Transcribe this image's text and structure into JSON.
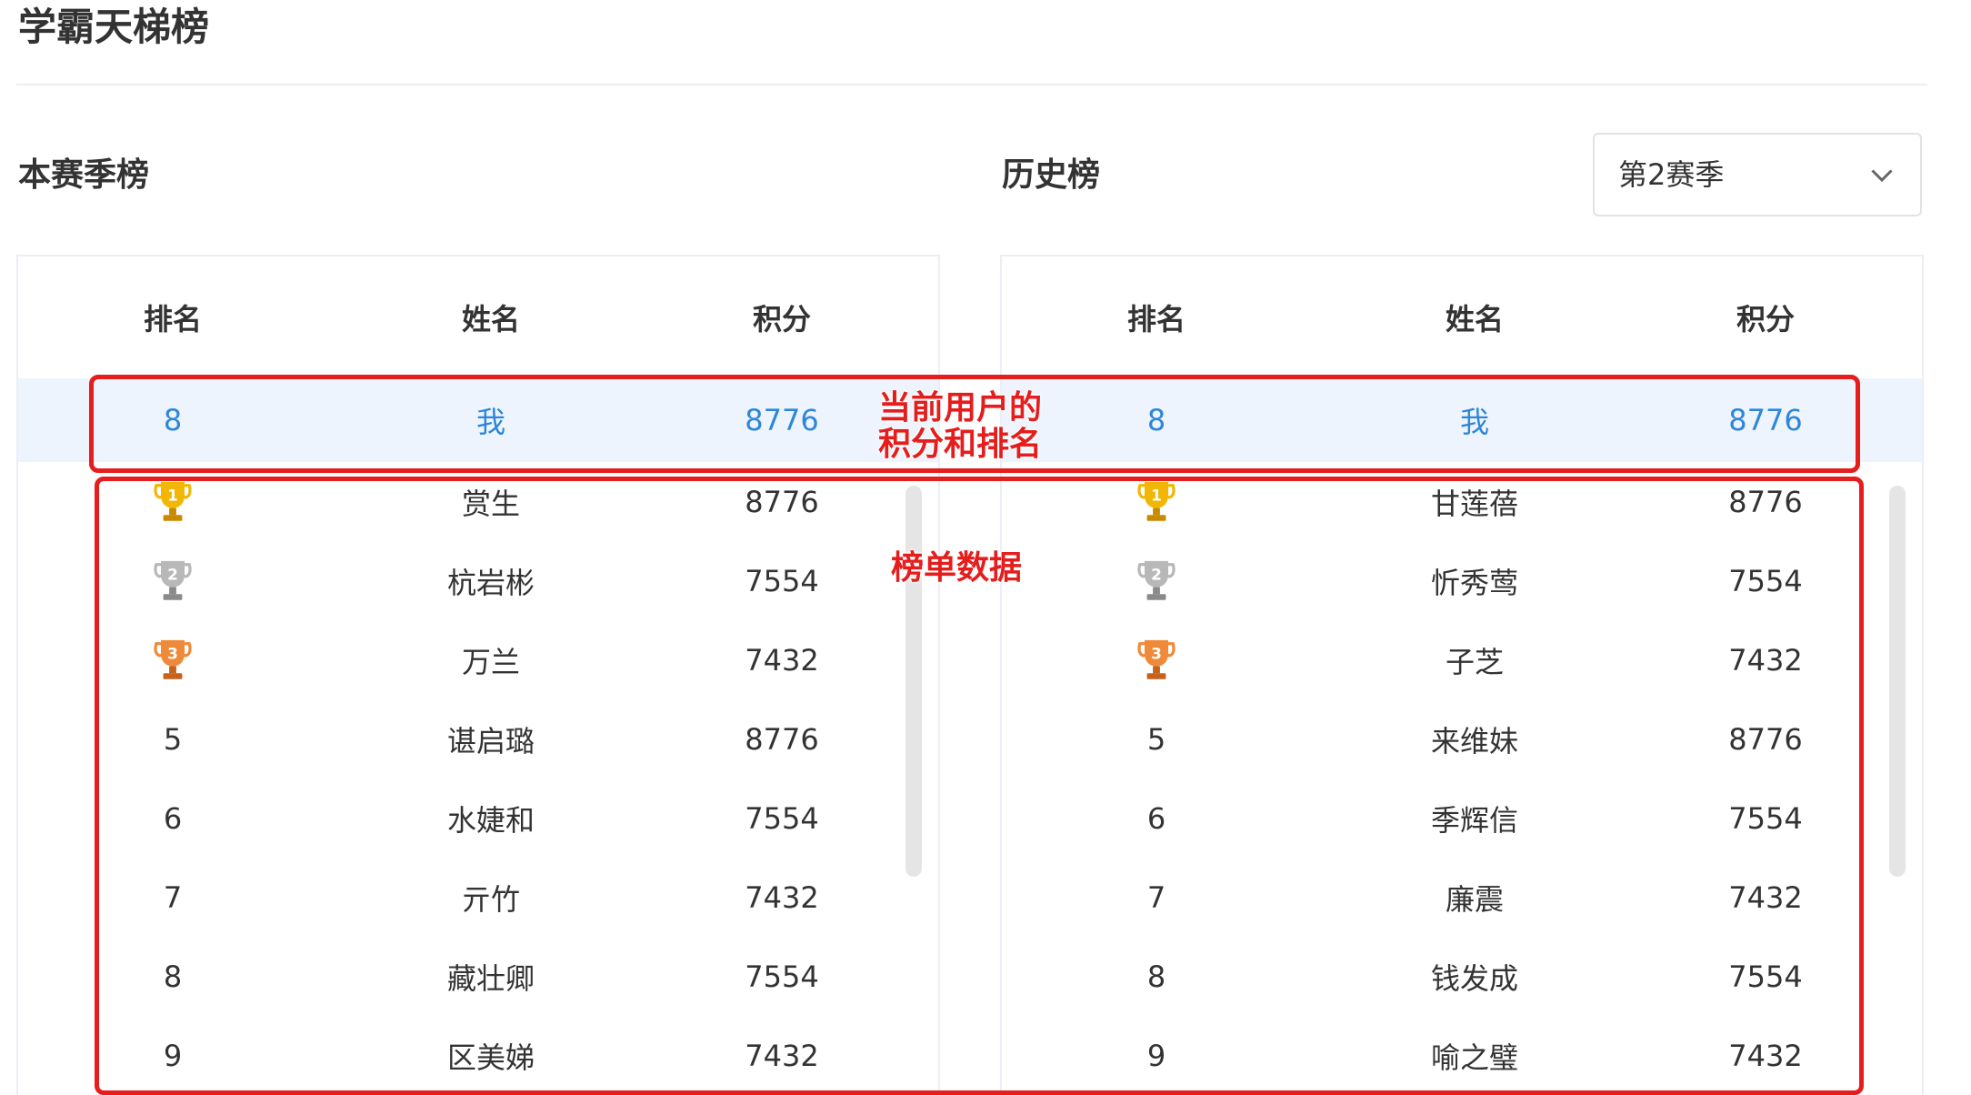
{
  "page": {
    "title": "学霸天梯榜"
  },
  "current_season": {
    "title": "本赛季榜",
    "headers": {
      "rank": "排名",
      "name": "姓名",
      "score": "积分"
    },
    "me": {
      "rank": "8",
      "name": "我",
      "score": "8776"
    },
    "rows": [
      {
        "rank": "1",
        "trophy": "gold",
        "name": "赏生",
        "score": "8776"
      },
      {
        "rank": "2",
        "trophy": "silver",
        "name": "杭岩彬",
        "score": "7554"
      },
      {
        "rank": "3",
        "trophy": "bronze",
        "name": "万兰",
        "score": "7432"
      },
      {
        "rank": "5",
        "name": "谌启璐",
        "score": "8776"
      },
      {
        "rank": "6",
        "name": "水婕和",
        "score": "7554"
      },
      {
        "rank": "7",
        "name": "亓竹",
        "score": "7432"
      },
      {
        "rank": "8",
        "name": "藏壮卿",
        "score": "7554"
      },
      {
        "rank": "9",
        "name": "区美娣",
        "score": "7432"
      }
    ]
  },
  "history": {
    "title": "历史榜",
    "season_select": {
      "value": "第2赛季"
    },
    "headers": {
      "rank": "排名",
      "name": "姓名",
      "score": "积分"
    },
    "me": {
      "rank": "8",
      "name": "我",
      "score": "8776"
    },
    "rows": [
      {
        "rank": "1",
        "trophy": "gold",
        "name": "甘莲蓓",
        "score": "8776"
      },
      {
        "rank": "2",
        "trophy": "silver",
        "name": "忻秀莺",
        "score": "7554"
      },
      {
        "rank": "3",
        "trophy": "bronze",
        "name": "子芝",
        "score": "7432"
      },
      {
        "rank": "5",
        "name": "来维妹",
        "score": "8776"
      },
      {
        "rank": "6",
        "name": "季辉信",
        "score": "7554"
      },
      {
        "rank": "7",
        "name": "廉震",
        "score": "7432"
      },
      {
        "rank": "8",
        "name": "钱发成",
        "score": "7554"
      },
      {
        "rank": "9",
        "name": "喻之璧",
        "score": "7432"
      }
    ]
  },
  "annotations": {
    "me_label": "当前用户的\n积分和排名",
    "list_label": "榜单数据"
  },
  "colors": {
    "accent_blue": "#2d86d9",
    "highlight_row": "#edf4fd",
    "annotation_red": "#e51d1d",
    "gold": "#f2b705",
    "silver": "#b8b8b8",
    "bronze": "#ee8a3a"
  }
}
